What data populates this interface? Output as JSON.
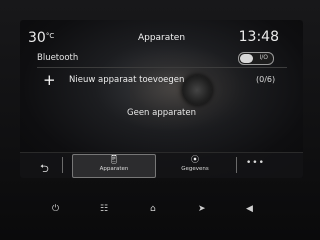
{
  "status": {
    "temperature": "30",
    "temperature_unit": "°C",
    "title": "Apparaten",
    "clock": "13:48"
  },
  "bluetooth": {
    "label": "Bluetooth",
    "toggle_text": "I/O"
  },
  "add_device": {
    "label": "Nieuw apparaat toevoegen",
    "count": "(0/6)"
  },
  "empty_message": "Geen apparaten",
  "tabs": [
    {
      "label": "Apparaten",
      "icon": "phone-icon",
      "active": true
    },
    {
      "label": "Gegevens",
      "icon": "signal-icon",
      "active": false
    }
  ],
  "hardware_buttons": [
    "power-icon",
    "apps-icon",
    "home-icon",
    "nav-icon",
    "volume-icon"
  ]
}
